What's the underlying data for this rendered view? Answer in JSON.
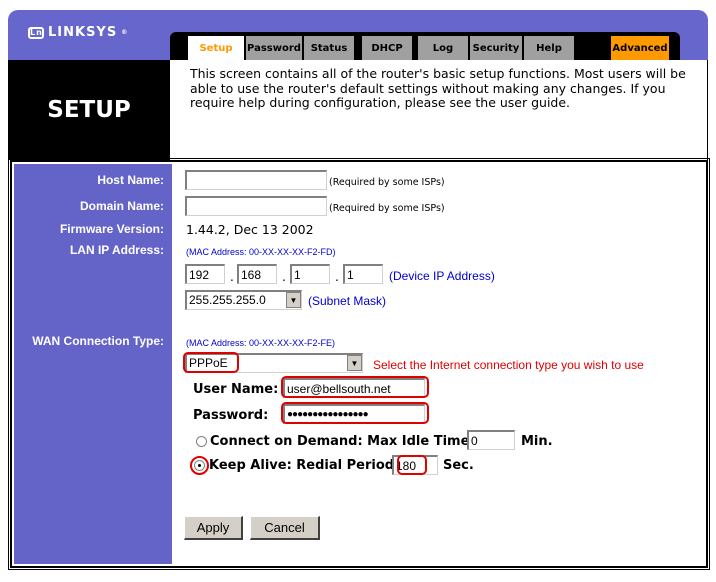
{
  "brand": {
    "logo_text": "LINKSYS",
    "logo_mark": "Ln",
    "registered": "®"
  },
  "tabs": [
    {
      "label": "Setup",
      "state": "active"
    },
    {
      "label": "Password",
      "state": "normal"
    },
    {
      "label": "Status",
      "state": "normal"
    },
    {
      "label": "DHCP",
      "state": "normal"
    },
    {
      "label": "Log",
      "state": "normal"
    },
    {
      "label": "Security",
      "state": "normal"
    },
    {
      "label": "Help",
      "state": "normal"
    },
    {
      "label": "Advanced",
      "state": "highlight"
    }
  ],
  "page": {
    "title": "SETUP",
    "intro": "This screen contains all of the router's basic setup functions. Most users will be able to use the router's default settings without making any changes. If you require help during configuration, please see the user guide."
  },
  "form": {
    "host_name": {
      "label": "Host Name:",
      "value": "",
      "hint": "(Required by some ISPs)"
    },
    "domain_name": {
      "label": "Domain Name:",
      "value": "",
      "hint": "(Required by some ISPs)"
    },
    "firmware": {
      "label": "Firmware Version:",
      "value": "1.44.2, Dec 13 2002"
    },
    "lan": {
      "label": "LAN IP Address:",
      "mac": "(MAC Address: 00-XX-XX-XX-F2-FD)",
      "ip": [
        "192",
        "168",
        "1",
        "1"
      ],
      "ip_sep": ".",
      "ip_hint": "(Device IP Address)",
      "subnet": "255.255.255.0",
      "subnet_hint": "(Subnet Mask)"
    },
    "wan": {
      "label": "WAN Connection Type:",
      "mac": "(MAC Address: 00-XX-XX-XX-F2-FE)",
      "type": "PPPoE",
      "type_hint": "Select the Internet connection type you wish to use",
      "user_label": "User Name:",
      "user_value": "user@bellsouth.net",
      "password_label": "Password:",
      "password_value": "●●●●●●●●●●●●●●●●",
      "connect_on_demand": {
        "label": "Connect on Demand: Max Idle Time",
        "value": "0",
        "unit": "Min.",
        "selected": false
      },
      "keep_alive": {
        "label": "Keep Alive: Redial Period",
        "value": "180",
        "unit": "Sec.",
        "selected": true
      }
    }
  },
  "buttons": {
    "apply": "Apply",
    "cancel": "Cancel"
  },
  "colors": {
    "sidebar": "#6464c8",
    "accent_orange": "#ff9900",
    "highlight_red": "#e00000",
    "link_blue": "#0000cc"
  }
}
